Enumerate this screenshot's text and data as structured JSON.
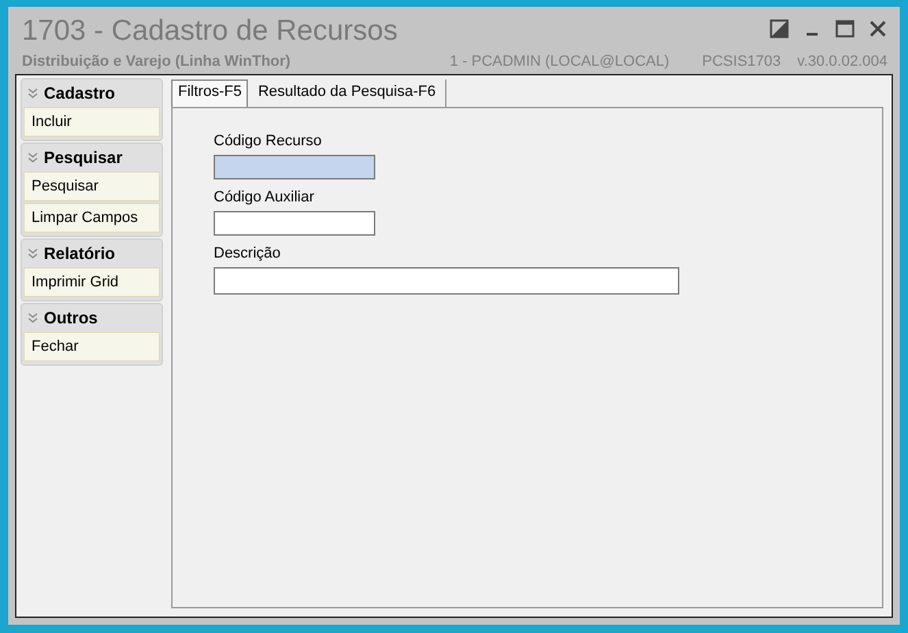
{
  "window": {
    "title": "1703 - Cadastro de Recursos",
    "subtitle": "Distribuição e Varejo (Linha WinThor)",
    "user": "1 - PCADMIN (LOCAL@LOCAL)",
    "program": "PCSIS1703",
    "version": "v.30.0.02.004"
  },
  "sidebar": {
    "groups": [
      {
        "title": "Cadastro",
        "expanded": true,
        "items": [
          "Incluir"
        ]
      },
      {
        "title": "Pesquisar",
        "expanded": true,
        "items": [
          "Pesquisar",
          "Limpar Campos"
        ]
      },
      {
        "title": "Relatório",
        "expanded": true,
        "items": [
          "Imprimir Grid"
        ]
      },
      {
        "title": "Outros",
        "expanded": true,
        "items": [
          "Fechar"
        ]
      }
    ]
  },
  "tabs": [
    {
      "label": "Filtros-F5",
      "selected": true
    },
    {
      "label": "Resultado da Pesquisa-F6",
      "selected": false
    }
  ],
  "fields": [
    {
      "label": "Código Recurso",
      "focused": true,
      "wide": false
    },
    {
      "label": "Código Auxiliar",
      "focused": false,
      "wide": false
    },
    {
      "label": "Descrição",
      "focused": false,
      "wide": true
    }
  ]
}
